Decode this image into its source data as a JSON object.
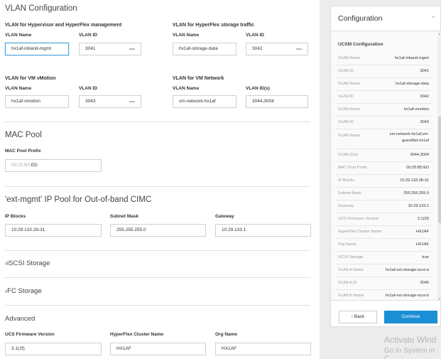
{
  "vlan": {
    "title": "VLAN Configuration",
    "hv_group": "VLAN for Hypervisor and HyperFlex management",
    "storage_group": "VLAN for HyperFlex storage traffic",
    "vmotion_group": "VLAN for VM vMotion",
    "vmnet_group": "VLAN for VM Network",
    "vlan_name_label": "VLAN Name",
    "vlan_id_label": "VLAN ID",
    "vlan_ids_label": "VLAN ID(s)",
    "hv_name": "hx1af-inband-mgmt",
    "hv_id": "3041",
    "storage_name": "hx1af-storage-data",
    "storage_id": "3042",
    "vmotion_name": "hx1af-vmotion",
    "vmotion_id": "3043",
    "vmnet_name": "vm-network-hx1af",
    "vmnet_ids": "3044,3004"
  },
  "mac": {
    "title": "MAC Pool",
    "prefix_label": "MAC Pool Prefix",
    "prefix_static": "00:25:B5:",
    "prefix_value": "ED"
  },
  "ip": {
    "title": "'ext-mgmt' IP Pool for Out-of-band CIMC",
    "blocks_label": "IP Blocks",
    "mask_label": "Subnet Mask",
    "gateway_label": "Gateway",
    "blocks": "10.29.133.28-31",
    "mask": "255.255.255.0",
    "gateway": "10.29.133.1"
  },
  "iscsi": {
    "title": "iSCSI Storage"
  },
  "fc": {
    "title": "FC Storage"
  },
  "advanced": {
    "title": "Advanced",
    "fw_label": "UCS Firmware Version",
    "cluster_label": "HyperFlex Cluster Name",
    "org_label": "Org Name",
    "fw": "3.1(2f)",
    "cluster": "HX1AF",
    "org": "HX1AF"
  },
  "panel": {
    "title": "Configuration",
    "subtitle": "UCSM Configuration",
    "rows": [
      {
        "k": "VLAN Name",
        "v": "hx1af-inband-mgmt"
      },
      {
        "k": "VLAN ID",
        "v": "3041"
      },
      {
        "k": "VLAN Name",
        "v": "hx1af-storage-data"
      },
      {
        "k": "VLAN ID",
        "v": "3042"
      },
      {
        "k": "VLAN Name",
        "v": "hx1af-vmotion"
      },
      {
        "k": "VLAN ID",
        "v": "3043"
      },
      {
        "k": "VLAN Name",
        "v": "vm-network-hx1af,vm-guestNet-hx1af"
      },
      {
        "k": "VLAN ID(s)",
        "v": "3044,3004"
      },
      {
        "k": "MAC Pool Prefix",
        "v": "00:25:B5:ED"
      },
      {
        "k": "IP Blocks",
        "v": "10.29.133.28-31"
      },
      {
        "k": "Subnet Mask",
        "v": "255.255.255.0"
      },
      {
        "k": "Gateway",
        "v": "10.29.133.1"
      },
      {
        "k": "UCS Firmware Version",
        "v": "3.1(2f)"
      },
      {
        "k": "HyperFlex Cluster Name",
        "v": "HX1AF"
      },
      {
        "k": "Org Name",
        "v": "HX1AF"
      },
      {
        "k": "iSCSI Storage",
        "v": "true"
      },
      {
        "k": "VLAN A Name",
        "v": "hx1af-ext-storage-iscsi-a"
      },
      {
        "k": "VLAN A ID",
        "v": "3045"
      },
      {
        "k": "VLAN B Name",
        "v": "hx1af-ext-storage-iscsi-b"
      }
    ],
    "back": "Back",
    "continue": "Continue"
  },
  "watermark": {
    "line1": "Activate Wind",
    "line2": "Go to System in C"
  }
}
